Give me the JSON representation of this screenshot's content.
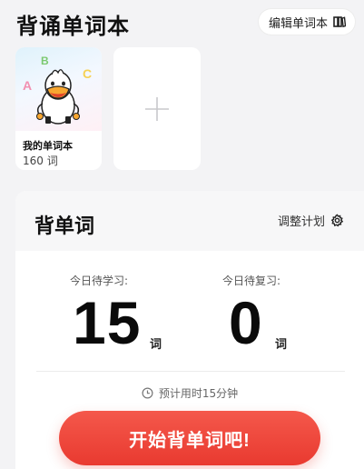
{
  "header": {
    "title": "背诵单词本",
    "edit_label": "编辑单词本"
  },
  "books": [
    {
      "name": "我的单词本",
      "count": "160 词",
      "cover_letters": [
        "B",
        "A",
        "C"
      ]
    }
  ],
  "plan": {
    "title": "背单词",
    "adjust_label": "调整计划",
    "learn_label": "今日待学习:",
    "learn_count": "15",
    "review_label": "今日待复习:",
    "review_count": "0",
    "unit": "词",
    "estimate": "预计用时15分钟",
    "start_label": "开始背单词吧!"
  },
  "colors": {
    "accent": "#e93a30",
    "background": "#f3f3f5"
  }
}
